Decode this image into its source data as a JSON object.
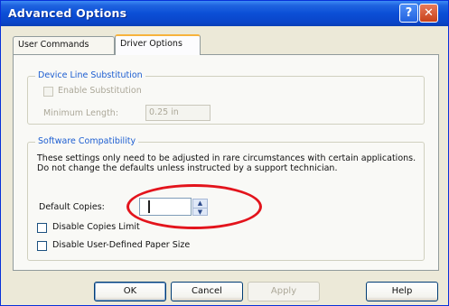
{
  "window": {
    "title": "Advanced Options",
    "help_glyph": "?",
    "close_glyph": "✕"
  },
  "tabs": [
    {
      "label": "User Commands"
    },
    {
      "label": "Driver Options"
    }
  ],
  "device_line": {
    "legend": "Device Line Substitution",
    "enable_label": "Enable Substitution",
    "min_length_label": "Minimum Length:",
    "min_length_value": "0.25 in"
  },
  "software": {
    "legend": "Software Compatibility",
    "description": "These settings only need to be adjusted in rare circumstances with certain applications.  Do not change the defaults unless instructed by a support technician.",
    "default_copies_label": "Default Copies:",
    "default_copies_value": "",
    "disable_copies_label": "Disable Copies Limit",
    "disable_paper_label": "Disable User-Defined Paper Size"
  },
  "buttons": {
    "ok": "OK",
    "cancel": "Cancel",
    "apply": "Apply",
    "help": "Help"
  },
  "icons": {
    "spin_up": "▲",
    "spin_down": "▼"
  },
  "colors": {
    "title_bar": "#0a45c9",
    "legend_text": "#1d5ed1",
    "annotation_ring": "#e3141c"
  }
}
